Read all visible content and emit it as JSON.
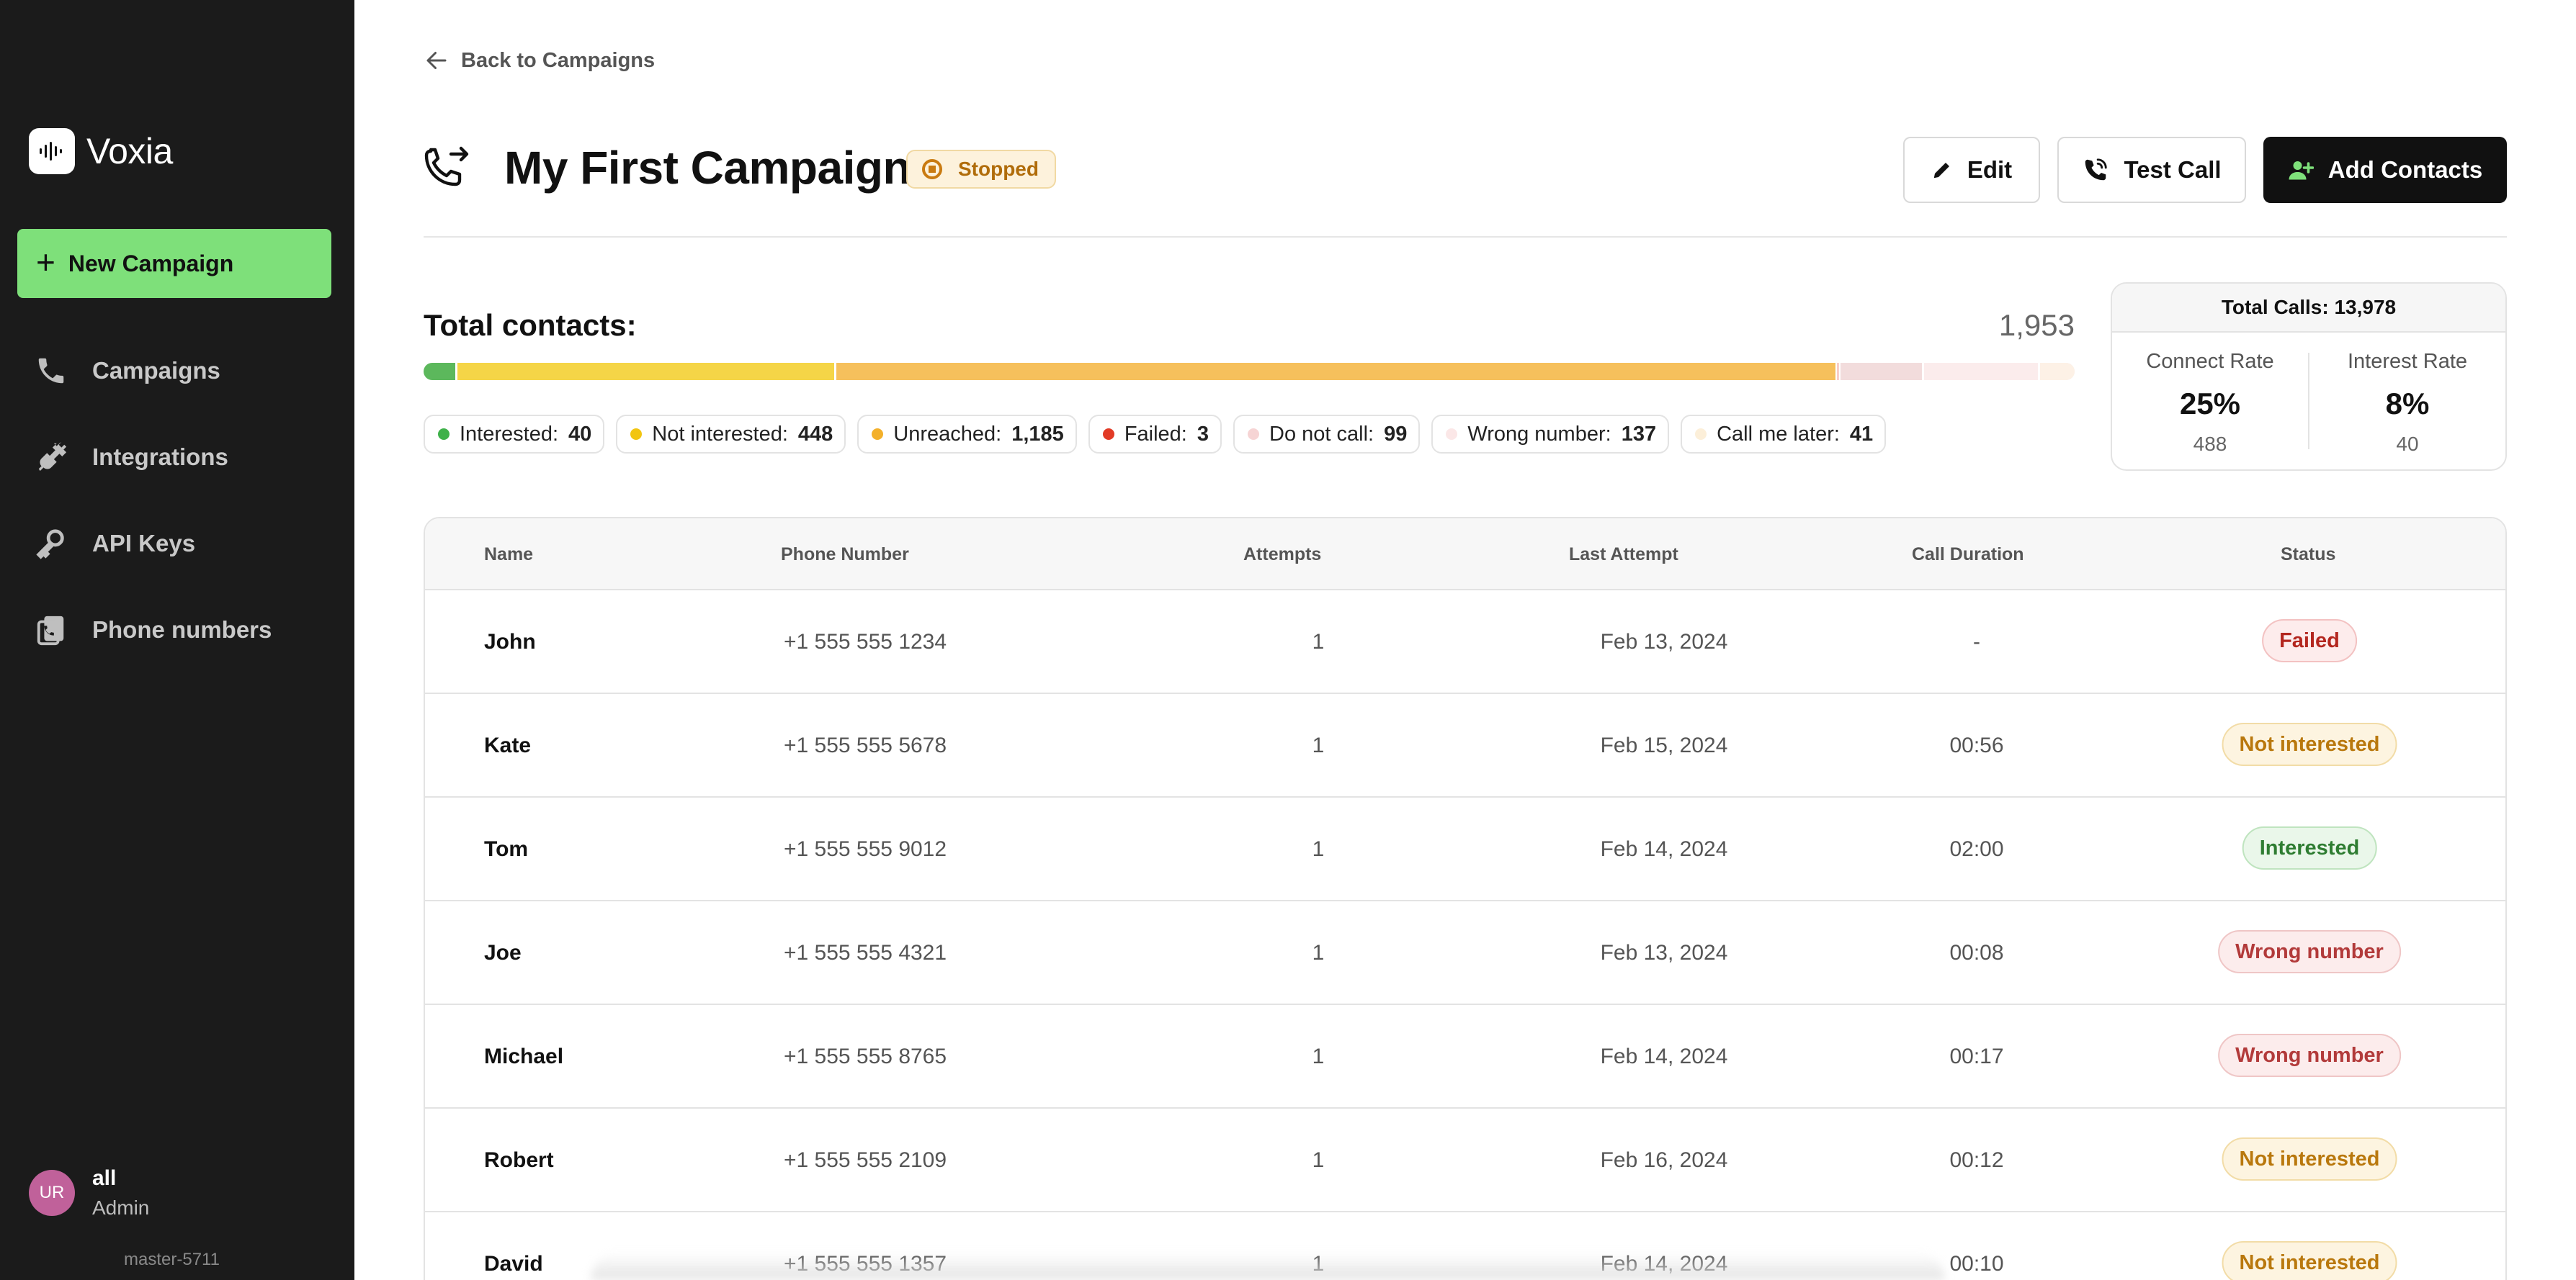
{
  "sidebar": {
    "brand": "Voxia",
    "new_campaign": "New Campaign",
    "items": [
      {
        "label": "Campaigns",
        "icon": "phone-icon"
      },
      {
        "label": "Integrations",
        "icon": "plug-icon"
      },
      {
        "label": "API Keys",
        "icon": "key-icon"
      },
      {
        "label": "Phone numbers",
        "icon": "phone-list-icon"
      }
    ],
    "user": {
      "initials": "UR",
      "name": "all",
      "role": "Admin"
    },
    "version": "master-5711"
  },
  "header": {
    "back": "Back to Campaigns",
    "title": "My First Campaign",
    "status": "Stopped",
    "buttons": {
      "edit": "Edit",
      "test_call": "Test Call",
      "add_contacts": "Add Contacts"
    }
  },
  "summary": {
    "total_label": "Total contacts:",
    "total_value": "1,953",
    "segments": [
      {
        "label": "Interested:",
        "value": "40",
        "count": 40,
        "color": "#5cb85c",
        "dot": "#3fb14a"
      },
      {
        "label": "Not interested:",
        "value": "448",
        "count": 448,
        "color": "#f5d547",
        "dot": "#f2c511"
      },
      {
        "label": "Unreached:",
        "value": "1,185",
        "count": 1185,
        "color": "#f6c05c",
        "dot": "#f3b02a"
      },
      {
        "label": "Failed:",
        "value": "3",
        "count": 3,
        "color": "#e8503a",
        "dot": "#e23b26"
      },
      {
        "label": "Do not call:",
        "value": "99",
        "count": 99,
        "color": "#f2dcdc",
        "dot": "#f6d4d4"
      },
      {
        "label": "Wrong number:",
        "value": "137",
        "count": 137,
        "color": "#fbecec",
        "dot": "#fbe7e7"
      },
      {
        "label": "Call me later:",
        "value": "41",
        "count": 41,
        "color": "#fdf1e6",
        "dot": "#fcefd9"
      }
    ]
  },
  "stats": {
    "total_calls": "Total Calls: 13,978",
    "connect": {
      "label": "Connect Rate",
      "pct": "25%",
      "count": "488"
    },
    "interest": {
      "label": "Interest Rate",
      "pct": "8%",
      "count": "40"
    }
  },
  "table": {
    "headers": {
      "name": "Name",
      "phone": "Phone Number",
      "attempts": "Attempts",
      "last": "Last Attempt",
      "duration": "Call Duration",
      "status": "Status"
    },
    "rows": [
      {
        "name": "John",
        "phone": "+1 555 555 1234",
        "attempts": "1",
        "last": "Feb 13, 2024",
        "duration": "-",
        "status": "Failed",
        "kind": "failed"
      },
      {
        "name": "Kate",
        "phone": "+1 555 555 5678",
        "attempts": "1",
        "last": "Feb 15, 2024",
        "duration": "00:56",
        "status": "Not interested",
        "kind": "not"
      },
      {
        "name": "Tom",
        "phone": "+1 555 555 9012",
        "attempts": "1",
        "last": "Feb 14, 2024",
        "duration": "02:00",
        "status": "Interested",
        "kind": "int"
      },
      {
        "name": "Joe",
        "phone": "+1 555 555 4321",
        "attempts": "1",
        "last": "Feb 13, 2024",
        "duration": "00:08",
        "status": "Wrong number",
        "kind": "wrong"
      },
      {
        "name": "Michael",
        "phone": "+1 555 555 8765",
        "attempts": "1",
        "last": "Feb 14, 2024",
        "duration": "00:17",
        "status": "Wrong number",
        "kind": "wrong"
      },
      {
        "name": "Robert",
        "phone": "+1 555 555 2109",
        "attempts": "1",
        "last": "Feb 16, 2024",
        "duration": "00:12",
        "status": "Not interested",
        "kind": "not"
      },
      {
        "name": "David",
        "phone": "+1 555 555 1357",
        "attempts": "1",
        "last": "Feb 14, 2024",
        "duration": "00:10",
        "status": "Not interested",
        "kind": "not"
      }
    ]
  }
}
